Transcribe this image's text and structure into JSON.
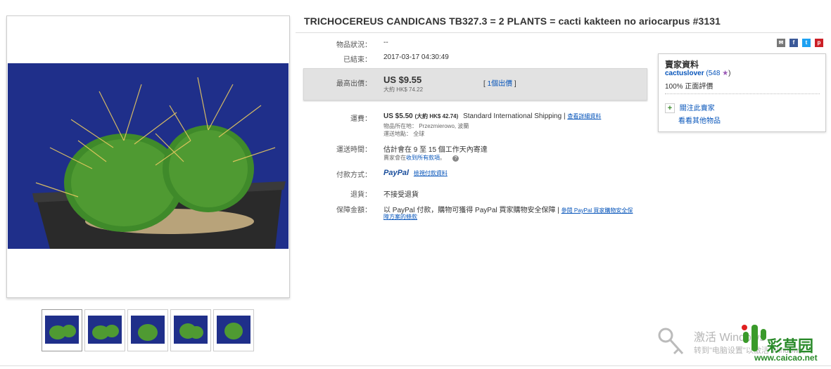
{
  "listing": {
    "title": "TRICHOCEREUS CANDICANS TB327.3 = 2 PLANTS = cacti kakteen no ariocarpus #3131"
  },
  "details": {
    "condition_label": "物品狀況：",
    "condition_value": "--",
    "ended_label": "已結束：",
    "ended_value": "2017-03-17  04:30:49",
    "bid_label": "最高出價：",
    "bid_price": "US $9.55",
    "bid_approx": "大約 HK$ 74.22",
    "bid_count_open": "[",
    "bid_count_link": "1個出價",
    "bid_count_close": "]",
    "shipping_label": "運費：",
    "shipping_price": "US $5.50",
    "shipping_approx": "(大約 HK$ 42.74)",
    "shipping_method": "Standard International Shipping",
    "shipping_sep": "|",
    "shipping_details_link": "查看詳細資料",
    "location_line": "物品所在地：  Przezmierowo, 波蘭",
    "ships_to_line": "運送地點：  全球",
    "delivery_label": "運送時間：",
    "delivery_value": "估計會在 9 至 15 個工作天內寄達",
    "delivery_note_prefix": "賣家會在",
    "delivery_note_link": "收到所有款項",
    "delivery_note_suffix": "。",
    "delivery_help": "?",
    "payment_label": "付款方式：",
    "paypal_logo": "PayPal",
    "payment_details_link": "檢視付款資料",
    "returns_label": "退貨：",
    "returns_value": "不接受退貨",
    "guarantee_label": "保障金額：",
    "guarantee_value": "以 PayPal 付款，購物可獲得 PayPal 買家購物安全保障 |",
    "guarantee_link": "參閱 PayPal 買家購物安全保",
    "guarantee_link2": "障方案的條款"
  },
  "seller": {
    "heading": "賣家資料",
    "name": "cactuslover",
    "score_open": "(",
    "score": "548",
    "score_close": ")",
    "feedback": "100% 正面評價",
    "follow_plus": "+",
    "follow": "關注此賣家",
    "see_other": "看看其他物品"
  },
  "share_icons": [
    {
      "name": "email",
      "glyph": "✉",
      "color": "#777777"
    },
    {
      "name": "facebook",
      "glyph": "f",
      "color": "#3b5998"
    },
    {
      "name": "twitter",
      "glyph": "t",
      "color": "#1da1f2"
    },
    {
      "name": "pinterest",
      "glyph": "p",
      "color": "#cb2027"
    }
  ],
  "colors": {
    "link": "#0654ba",
    "photo_bg": "#1f2f8a",
    "bid_box": "#e2e2e2"
  },
  "thumbnails_count": 5,
  "watermark": {
    "line1": "激活 Windows",
    "line2": "转到\"电脑设置\"以激活 Windows。",
    "brand": "彩草园",
    "brand_url": "www.caicao.net"
  }
}
